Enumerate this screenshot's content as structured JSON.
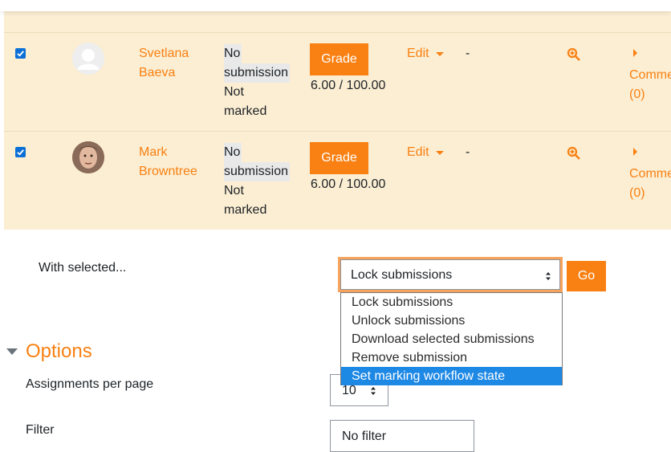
{
  "rows": [
    {
      "selected": true,
      "name_line1": "Svetlana",
      "name_line2": "Baeva",
      "status_line1": "No",
      "status_line2": "submission",
      "status_line3": "Not",
      "status_line4": "marked",
      "grade_button": "Grade",
      "grade_value": "6.00 / 100.00",
      "edit_label": "Edit",
      "dash": "-",
      "comments_line1": "Comme",
      "comments_line2": "(0)"
    },
    {
      "selected": true,
      "name_line1": "Mark",
      "name_line2": "Browntree",
      "status_line1": "No",
      "status_line2": "submission",
      "status_line3": "Not",
      "status_line4": "marked",
      "grade_button": "Grade",
      "grade_value": "6.00 / 100.00",
      "edit_label": "Edit",
      "dash": "-",
      "comments_line1": "Comme",
      "comments_line2": "(0)"
    }
  ],
  "bulk": {
    "label": "With selected...",
    "selected_value": "Lock submissions",
    "go_label": "Go",
    "options": [
      "Lock submissions",
      "Unlock submissions",
      "Download selected submissions",
      "Remove submission",
      "Set marking workflow state"
    ],
    "highlighted_option": "Set marking workflow state"
  },
  "options_section": {
    "title": "Options",
    "per_page_label": "Assignments per page",
    "per_page_value": "10",
    "filter_label": "Filter",
    "filter_value": "No filter"
  },
  "colors": {
    "accent": "#f98012",
    "row_bg": "#fbeed3",
    "select_highlight": "#1e88e5"
  }
}
